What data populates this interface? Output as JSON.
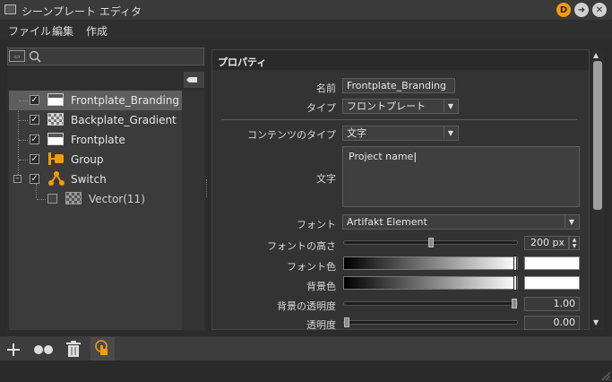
{
  "window": {
    "title": "シーンプレート エディタ",
    "btn_d": "D",
    "btn_forward": "➜",
    "btn_close": "✕"
  },
  "menu": {
    "file": "ファイル",
    "edit": "編集",
    "create": "作成"
  },
  "tree": {
    "items": [
      {
        "label": "Frontplate_Branding",
        "checked": "✓"
      },
      {
        "label": "Backplate_Gradient",
        "checked": "✓"
      },
      {
        "label": "Frontplate",
        "checked": "✓"
      },
      {
        "label": "Group",
        "checked": "✓"
      },
      {
        "label": "Switch",
        "checked": "✓"
      },
      {
        "label": "Vector(11)",
        "checked": ""
      }
    ]
  },
  "properties": {
    "header": "プロパティ",
    "name_label": "名前",
    "name_value": "Frontplate_Branding",
    "type_label": "タイプ",
    "type_value": "フロントプレート",
    "content_type_label": "コンテンツのタイプ",
    "content_type_value": "文字",
    "text_label": "文字",
    "text_value": "Project name",
    "font_label": "フォント",
    "font_value": "Artifakt Element",
    "font_height_label": "フォントの高さ",
    "font_height_value": "200 px",
    "font_height_level": 0.5,
    "font_color_label": "フォント色",
    "bg_color_label": "背景色",
    "bg_opacity_label": "背景の透明度",
    "bg_opacity_value": "1.00",
    "opacity_label": "透明度",
    "opacity_value": "0.00"
  },
  "colors": {
    "accent": "#f39c12",
    "selection": "#5e5e5e"
  }
}
